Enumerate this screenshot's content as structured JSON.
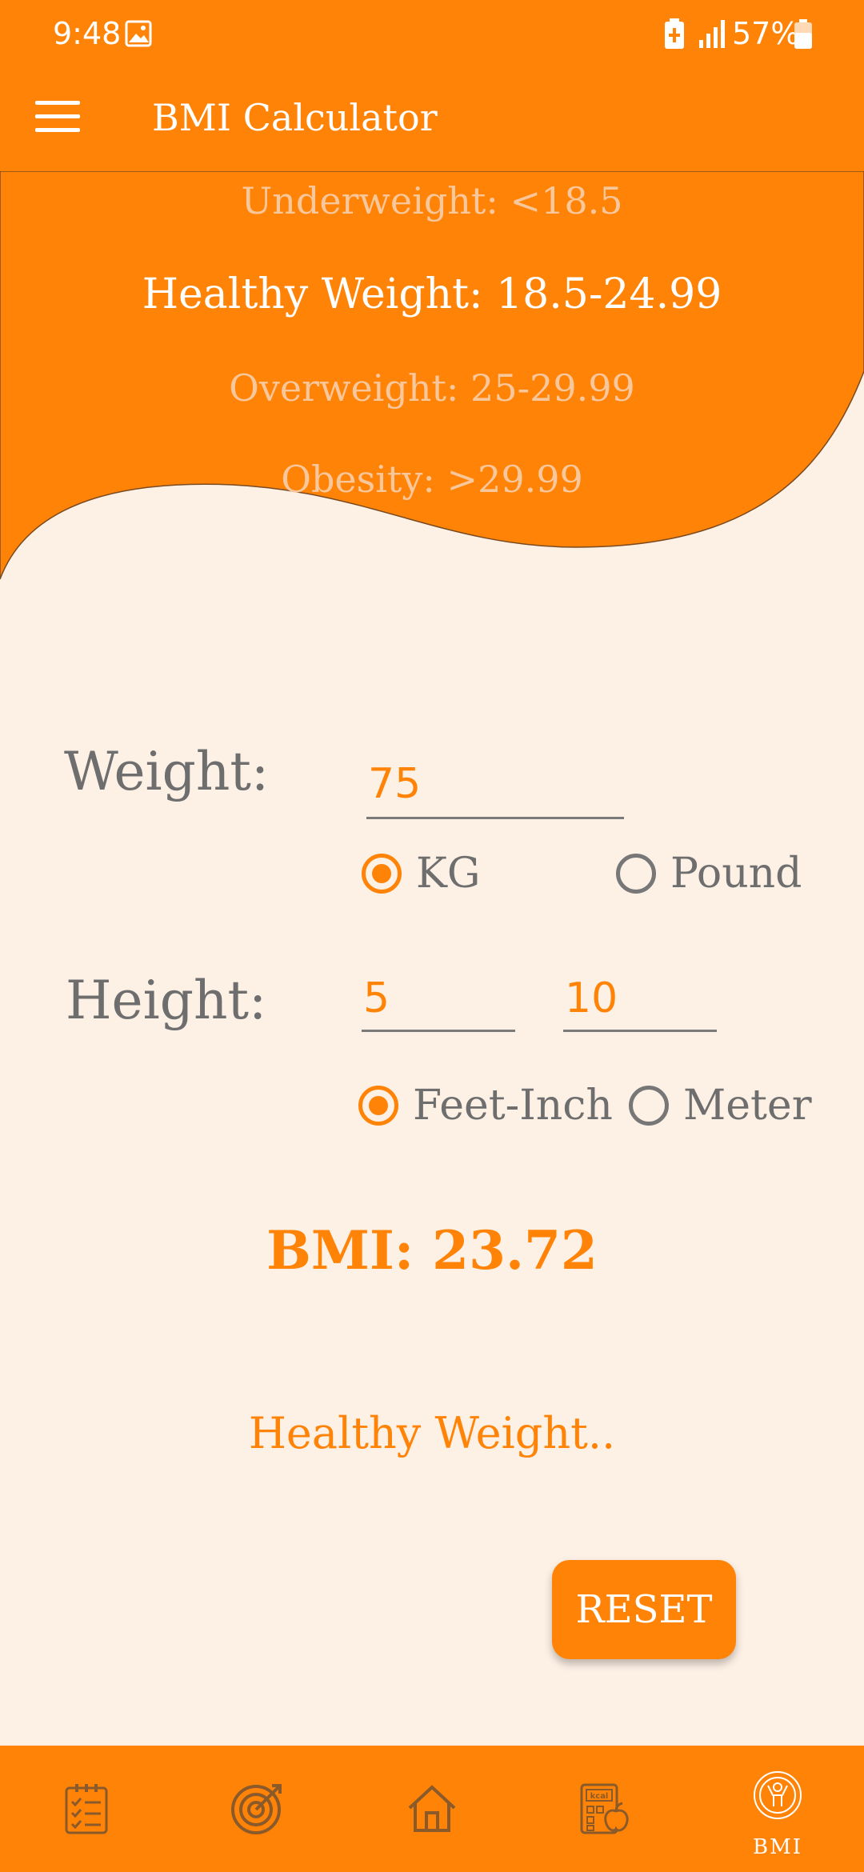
{
  "status_bar": {
    "time": "9:48",
    "battery": "57%"
  },
  "app_bar": {
    "title": "BMI Calculator"
  },
  "ranges": {
    "underweight": "Underweight: <18.5",
    "healthy": "Healthy Weight: 18.5-24.99",
    "overweight": "Overweight: 25-29.99",
    "obesity": "Obesity: >29.99"
  },
  "weight": {
    "label": "Weight:",
    "value": "75",
    "units": {
      "kg": "KG",
      "pound": "Pound",
      "selected": "KG"
    }
  },
  "height": {
    "label": "Height:",
    "feet_value": "5",
    "inch_value": "10",
    "units": {
      "feet_inch": "Feet-Inch",
      "meter": "Meter",
      "selected": "Feet-Inch"
    }
  },
  "result": {
    "bmi": "BMI: 23.72",
    "status": "Healthy Weight.."
  },
  "actions": {
    "reset": "RESET"
  },
  "bottom_nav": {
    "items": [
      {
        "icon": "checklist-icon"
      },
      {
        "icon": "target-icon"
      },
      {
        "icon": "home-icon"
      },
      {
        "icon": "calorie-calculator-icon"
      },
      {
        "icon": "bmi-icon",
        "label": "BMI"
      }
    ]
  },
  "colors": {
    "accent": "#FF8307",
    "background": "#FDF0E5",
    "text_gray": "#6E6E6E"
  }
}
